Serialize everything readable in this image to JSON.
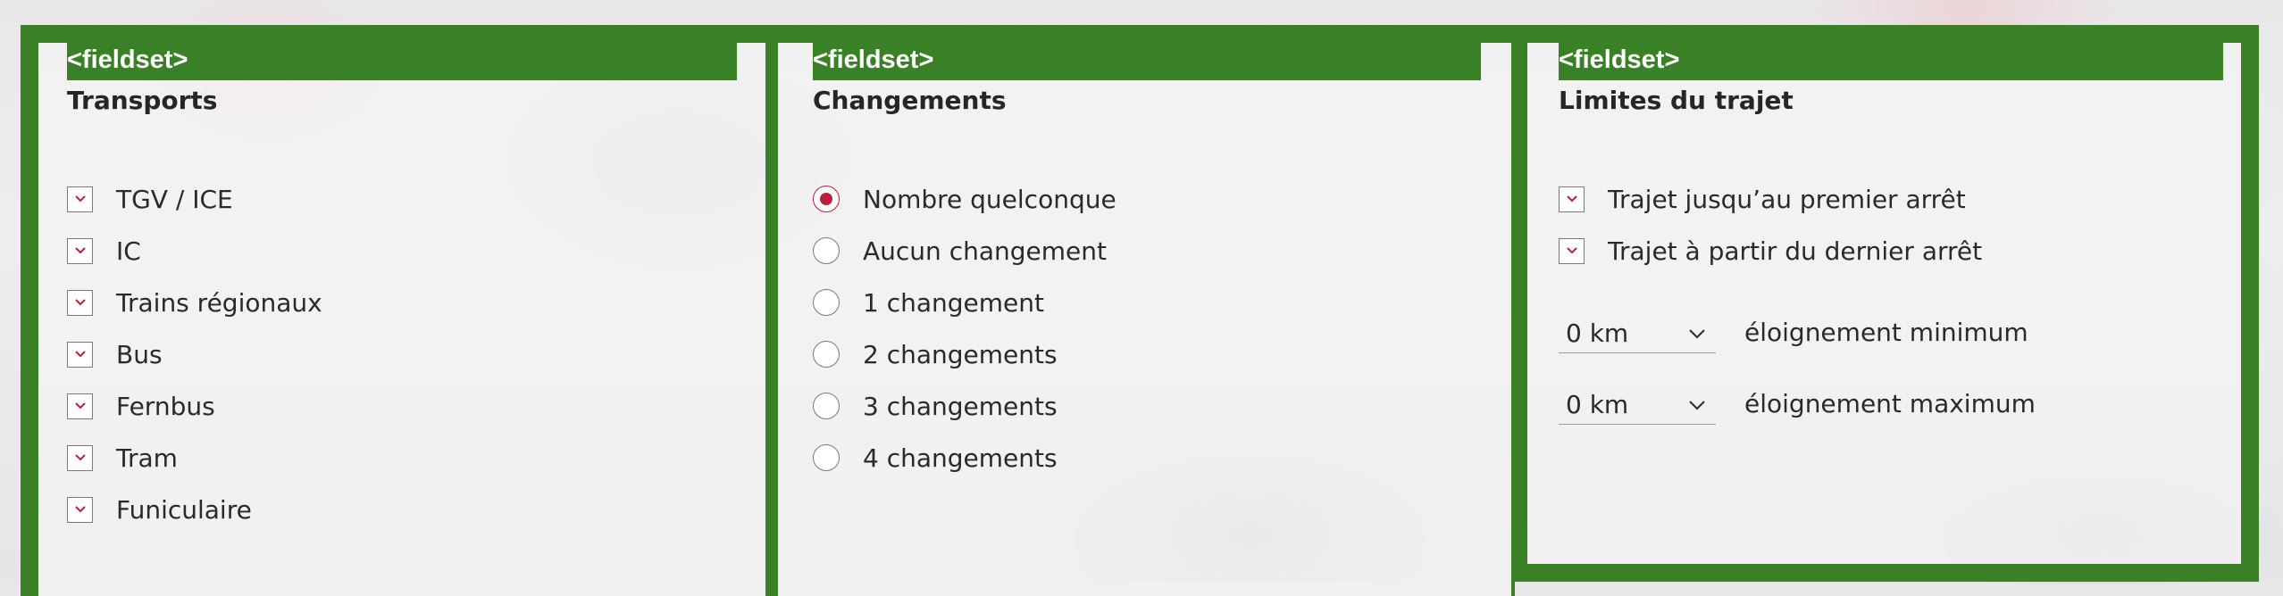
{
  "colors": {
    "frame": "#3a8026",
    "accent": "#b8203b"
  },
  "panel1": {
    "tag": "<fieldset>",
    "legend": "Transports",
    "options": [
      {
        "label": "TGV / ICE",
        "checked": true
      },
      {
        "label": "IC",
        "checked": true
      },
      {
        "label": "Trains régionaux",
        "checked": true
      },
      {
        "label": "Bus",
        "checked": true
      },
      {
        "label": "Fernbus",
        "checked": true
      },
      {
        "label": "Tram",
        "checked": true
      },
      {
        "label": "Funiculaire",
        "checked": true
      }
    ]
  },
  "panel2": {
    "tag": "<fieldset>",
    "legend": "Changements",
    "options": [
      {
        "label": "Nombre quelconque",
        "selected": true
      },
      {
        "label": "Aucun changement",
        "selected": false
      },
      {
        "label": "1 changement",
        "selected": false
      },
      {
        "label": "2 changements",
        "selected": false
      },
      {
        "label": "3 changements",
        "selected": false
      },
      {
        "label": "4 changements",
        "selected": false
      }
    ]
  },
  "panel3": {
    "tag": "<fieldset>",
    "legend": "Limites du trajet",
    "options": [
      {
        "label": "Trajet jusqu’au premier arrêt",
        "checked": true
      },
      {
        "label": "Trajet à partir du dernier arrêt",
        "checked": true
      }
    ],
    "selects": [
      {
        "value": "0 km",
        "label": "éloignement minimum"
      },
      {
        "value": "0 km",
        "label": "éloignement maximum"
      }
    ]
  }
}
